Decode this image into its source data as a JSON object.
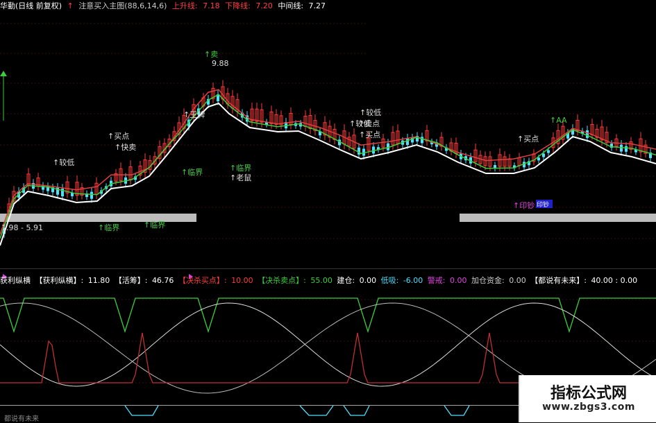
{
  "header": {
    "title": "华勤(日线 前复权)",
    "arrow": "↑",
    "indicator_name": "注意买入主图(88,6,14,6)",
    "up_label": "上升线:",
    "up_value": "7.18",
    "down_label": "下降线:",
    "down_value": "7.20",
    "mid_label": "中间线:",
    "mid_value": "7.27"
  },
  "annotations": {
    "low_range": "1.98 - 5.91",
    "peak_price": "9.88",
    "sell": "↑卖",
    "buy_1": "↑买点",
    "fast_sell": "↑快卖",
    "relatively_low": "↑较低",
    "boundary_1": "↑临界",
    "boundary_2": "↑临界",
    "boundary_3": "↑临界",
    "boundary_4": "↑临界",
    "old_mouse": "↑老鼠",
    "king": "↑王牌",
    "relatively_low_2": "↑较低",
    "relatively_low_3": "↑较低",
    "buy_2": "↑买点",
    "sell_point": "↑卖点",
    "buy_3": "↑买点",
    "aa": "↑AA",
    "print_money": "↑印钞",
    "money_badge": "印钞"
  },
  "indicator": {
    "title": "获利纵横",
    "l1": "【获利纵横】:",
    "v1": "11.80",
    "l2": "【活筹】:",
    "v2": "46.76",
    "l3": "【决杀买点】:",
    "v3": "10.00",
    "l4": "【决杀卖点】:",
    "v4": "55.00",
    "l5": "建仓:",
    "v5": "0.00",
    "l6": "低吸:",
    "v6": "-6.00",
    "l7": "警戒:",
    "v7": "0.00",
    "l8": "加仓资金:",
    "v8": "0.00",
    "l9": "【都说有未来】:",
    "v9": "40.00 : 0.00"
  },
  "bottom": {
    "label": "都说有未来"
  },
  "watermark": {
    "title": "指标公式网",
    "url": "www.zbgs3.com"
  },
  "colors": {
    "up": "#ff3b3b",
    "down": "#4fe0ff",
    "ma_white": "#ffffff",
    "ma_green": "#3ccc3c",
    "ma_red": "#e04040",
    "gray_band": "#bcbcbc",
    "yellow": "#f5c518",
    "magenta": "#e040e0"
  }
}
